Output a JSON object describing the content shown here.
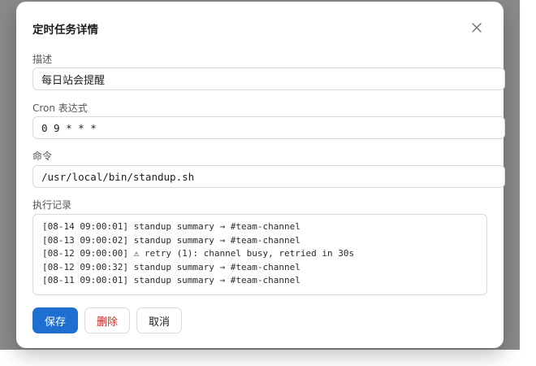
{
  "dialog": {
    "title": "定时任务详情",
    "close_icon": "close-icon"
  },
  "fields": {
    "description": {
      "label": "描述",
      "value": "每日站会提醒"
    },
    "cron": {
      "label": "Cron 表达式",
      "value": "0 9 * * *"
    },
    "command": {
      "label": "命令",
      "value": "/usr/local/bin/standup.sh"
    }
  },
  "log": {
    "label": "执行记录",
    "lines": [
      "[08-14 09:00:01] standup summary → #team-channel",
      "[08-13 09:00:02] standup summary → #team-channel",
      "[08-12 09:00:00] ⚠ retry (1): channel busy, retried in 30s",
      "[08-12 09:00:32] standup summary → #team-channel",
      "[08-11 09:00:01] standup summary → #team-channel"
    ]
  },
  "actions": {
    "save_label": "保存",
    "delete_label": "删除",
    "cancel_label": "取消"
  },
  "colors": {
    "primary": "#1f6fd0",
    "danger": "#c4302b",
    "border": "#d9d9dd",
    "backdrop": "#8a8a8c"
  }
}
